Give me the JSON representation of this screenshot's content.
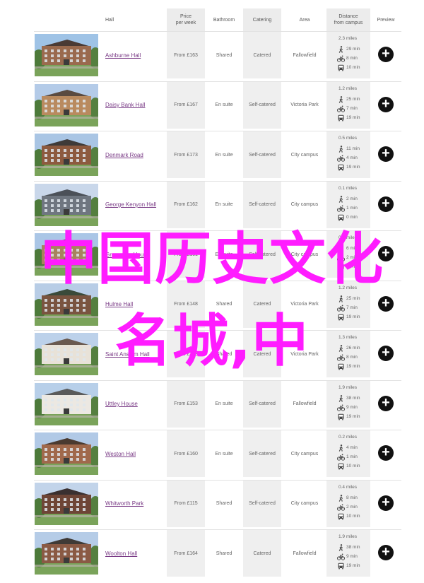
{
  "header": {
    "hall": "Hall",
    "price": "Price\nper week",
    "bathroom": "Bathroom",
    "catering": "Catering",
    "area": "Area",
    "distance": "Distance\nfrom campus",
    "preview": "Preview"
  },
  "rows": [
    {
      "name": "Ashburne Hall",
      "price": "From £163",
      "bathroom": "Shared",
      "catering": "Catered",
      "area": "Fallowfield",
      "miles": "2.3 miles",
      "walk": "29 min",
      "bike": "8 min",
      "bus": "10 min",
      "plus": "+"
    },
    {
      "name": "Daisy Bank Hall",
      "price": "From £167",
      "bathroom": "En suite",
      "catering": "Self-catered",
      "area": "Victoria Park",
      "miles": "1.2 miles",
      "walk": "25 min",
      "bike": "7 min",
      "bus": "19 min",
      "plus": "+"
    },
    {
      "name": "Denmark Road",
      "price": "From £173",
      "bathroom": "En suite",
      "catering": "Self-catered",
      "area": "City campus",
      "miles": "0.5 miles",
      "walk": "11 min",
      "bike": "4 min",
      "bus": "19 min",
      "plus": "+"
    },
    {
      "name": "George Kenyon Hall",
      "price": "From £162",
      "bathroom": "En suite",
      "catering": "Self-catered",
      "area": "City campus",
      "miles": "0.1 miles",
      "walk": "2 min",
      "bike": "1 min",
      "bus": "0 min",
      "plus": "+"
    },
    {
      "name": "Grosvenor House",
      "price": "From £161",
      "bathroom": "En suite",
      "catering": "Self-catered",
      "area": "City campus",
      "miles": "0.3 miles",
      "walk": "6 min",
      "bike": "2 min",
      "bus": "10 min",
      "plus": "+"
    },
    {
      "name": "Hulme Hall",
      "price": "From £148",
      "bathroom": "Shared",
      "catering": "Catered",
      "area": "Victoria Park",
      "miles": "1.2 miles",
      "walk": "25 min",
      "bike": "7 min",
      "bus": "19 min",
      "plus": "+"
    },
    {
      "name": "Saint Anselm Hall",
      "price": "From £163",
      "bathroom": "Shared",
      "catering": "Catered",
      "area": "Victoria Park",
      "miles": "1.3 miles",
      "walk": "26 min",
      "bike": "8 min",
      "bus": "19 min",
      "plus": "+"
    },
    {
      "name": "Uttley House",
      "price": "From £153",
      "bathroom": "En suite",
      "catering": "Self-catered",
      "area": "Fallowfield",
      "miles": "1.9 miles",
      "walk": "38 min",
      "bike": "9 min",
      "bus": "19 min",
      "plus": "+"
    },
    {
      "name": "Weston Hall",
      "price": "From £160",
      "bathroom": "En suite",
      "catering": "Self-catered",
      "area": "City campus",
      "miles": "0.2 miles",
      "walk": "4 min",
      "bike": "1 min",
      "bus": "10 min",
      "plus": "+"
    },
    {
      "name": "Whitworth Park",
      "price": "From £115",
      "bathroom": "Shared",
      "catering": "Self-catered",
      "area": "City campus",
      "miles": "0.4 miles",
      "walk": "8 min",
      "bike": "2 min",
      "bus": "10 min",
      "plus": "+"
    },
    {
      "name": "Woolton Hall",
      "price": "From £164",
      "bathroom": "Shared",
      "catering": "Catered",
      "area": "Fallowfield",
      "miles": "1.9 miles",
      "walk": "38 min",
      "bike": "9 min",
      "bus": "19 min",
      "plus": "+"
    }
  ],
  "overlay": {
    "line1": "中国历史文化",
    "line2": "名城,中"
  },
  "colors": {
    "link": "#7a3b86",
    "overlay": "#ff1cff",
    "column_shade": "#efefef",
    "preview_button": "#111111"
  }
}
